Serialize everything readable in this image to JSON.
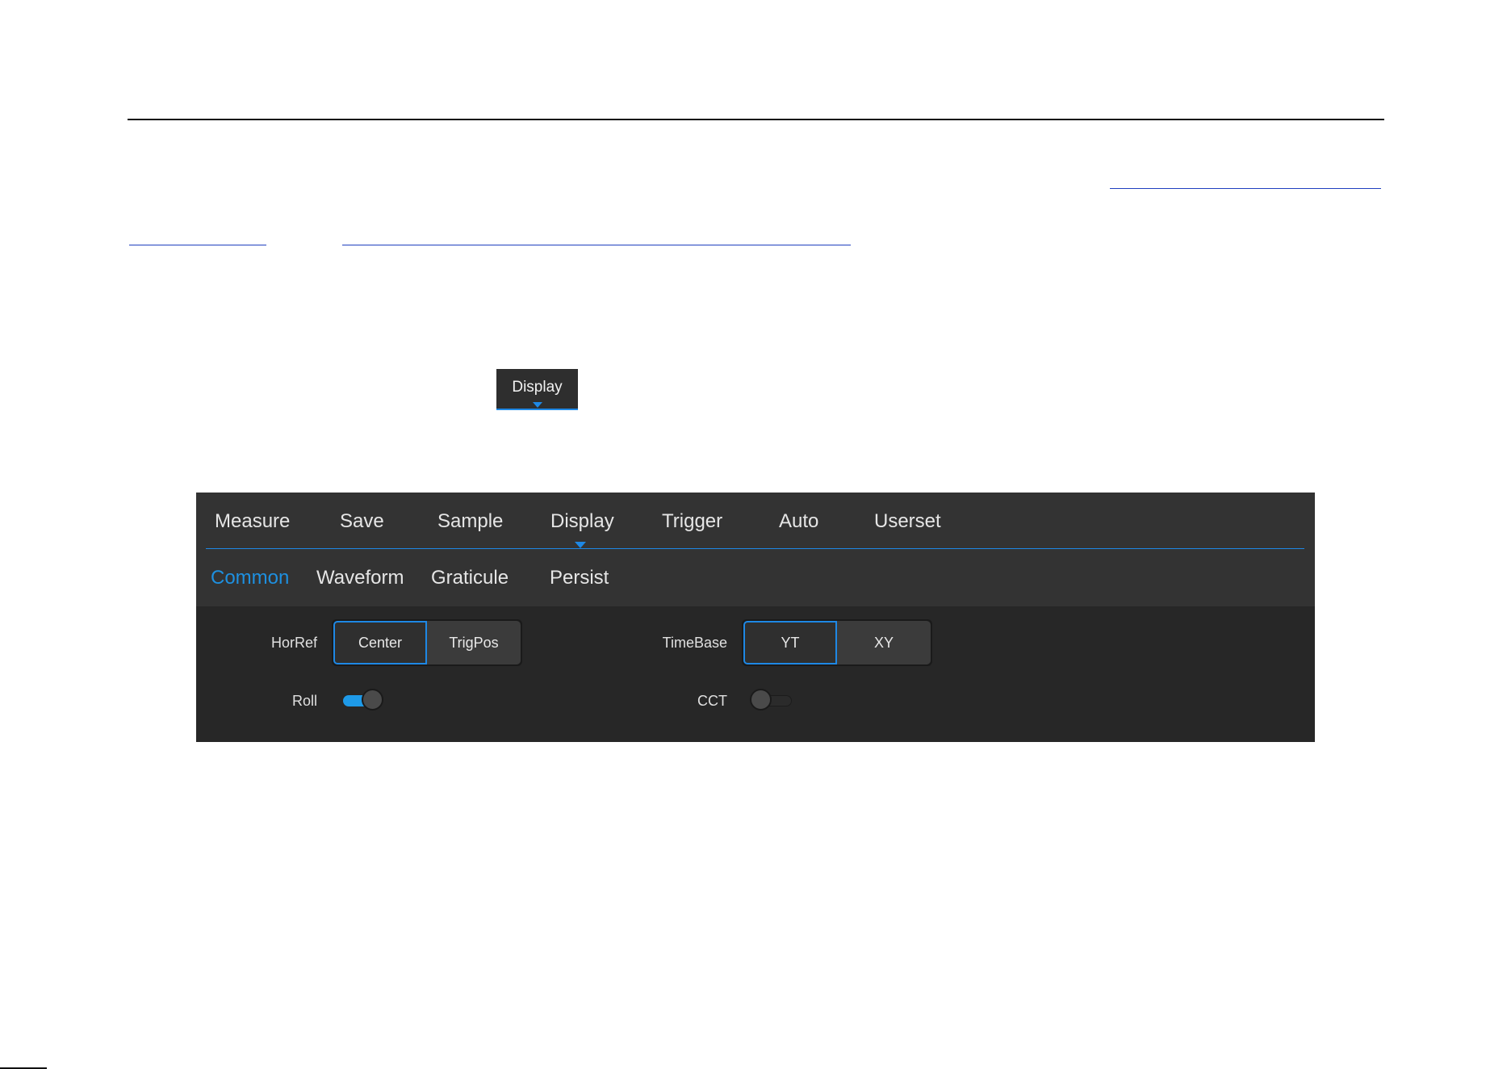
{
  "display_chip": {
    "label": "Display"
  },
  "menu": {
    "items": [
      {
        "label": "Measure"
      },
      {
        "label": "Save"
      },
      {
        "label": "Sample"
      },
      {
        "label": "Display"
      },
      {
        "label": "Trigger"
      },
      {
        "label": "Auto"
      },
      {
        "label": "Userset"
      }
    ],
    "active": "Display"
  },
  "submenu": {
    "items": [
      {
        "label": "Common"
      },
      {
        "label": "Waveform"
      },
      {
        "label": "Graticule"
      },
      {
        "label": "Persist"
      }
    ],
    "active": "Common"
  },
  "settings": {
    "horref": {
      "label": "HorRef",
      "options": [
        "Center",
        "TrigPos"
      ],
      "selected": "Center"
    },
    "timebase": {
      "label": "TimeBase",
      "options": [
        "YT",
        "XY"
      ],
      "selected": "YT"
    },
    "roll": {
      "label": "Roll",
      "state": "on"
    },
    "cct": {
      "label": "CCT",
      "state": "off"
    }
  },
  "colors": {
    "accent": "#1e88e5",
    "panel_bg": "#333333",
    "settings_bg": "#272727",
    "text": "#e6e6e6"
  }
}
